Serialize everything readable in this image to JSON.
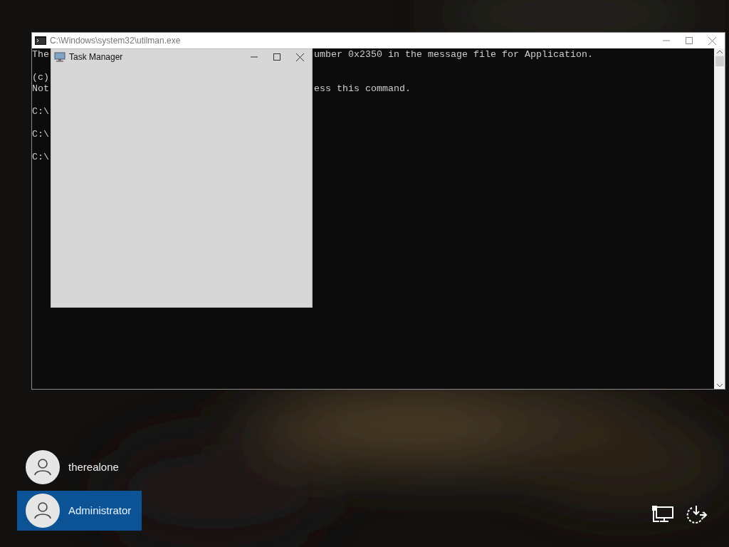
{
  "console": {
    "title": "C:\\Windows\\system32\\utilman.exe",
    "blocks": [
      [
        {
          "left": "The",
          "right": "umber 0x2350 in the message file for Application."
        }
      ],
      [
        {
          "left": "(c)"
        },
        {
          "left": "Not",
          "right": "ess this command."
        }
      ],
      [
        {
          "left": "C:\\"
        }
      ],
      [
        {
          "left": "C:\\"
        }
      ],
      [
        {
          "left": "C:\\"
        }
      ]
    ]
  },
  "task_manager": {
    "title": "Task Manager"
  },
  "users": [
    {
      "name": "therealone",
      "selected": false
    },
    {
      "name": "Administrator",
      "selected": true
    }
  ]
}
